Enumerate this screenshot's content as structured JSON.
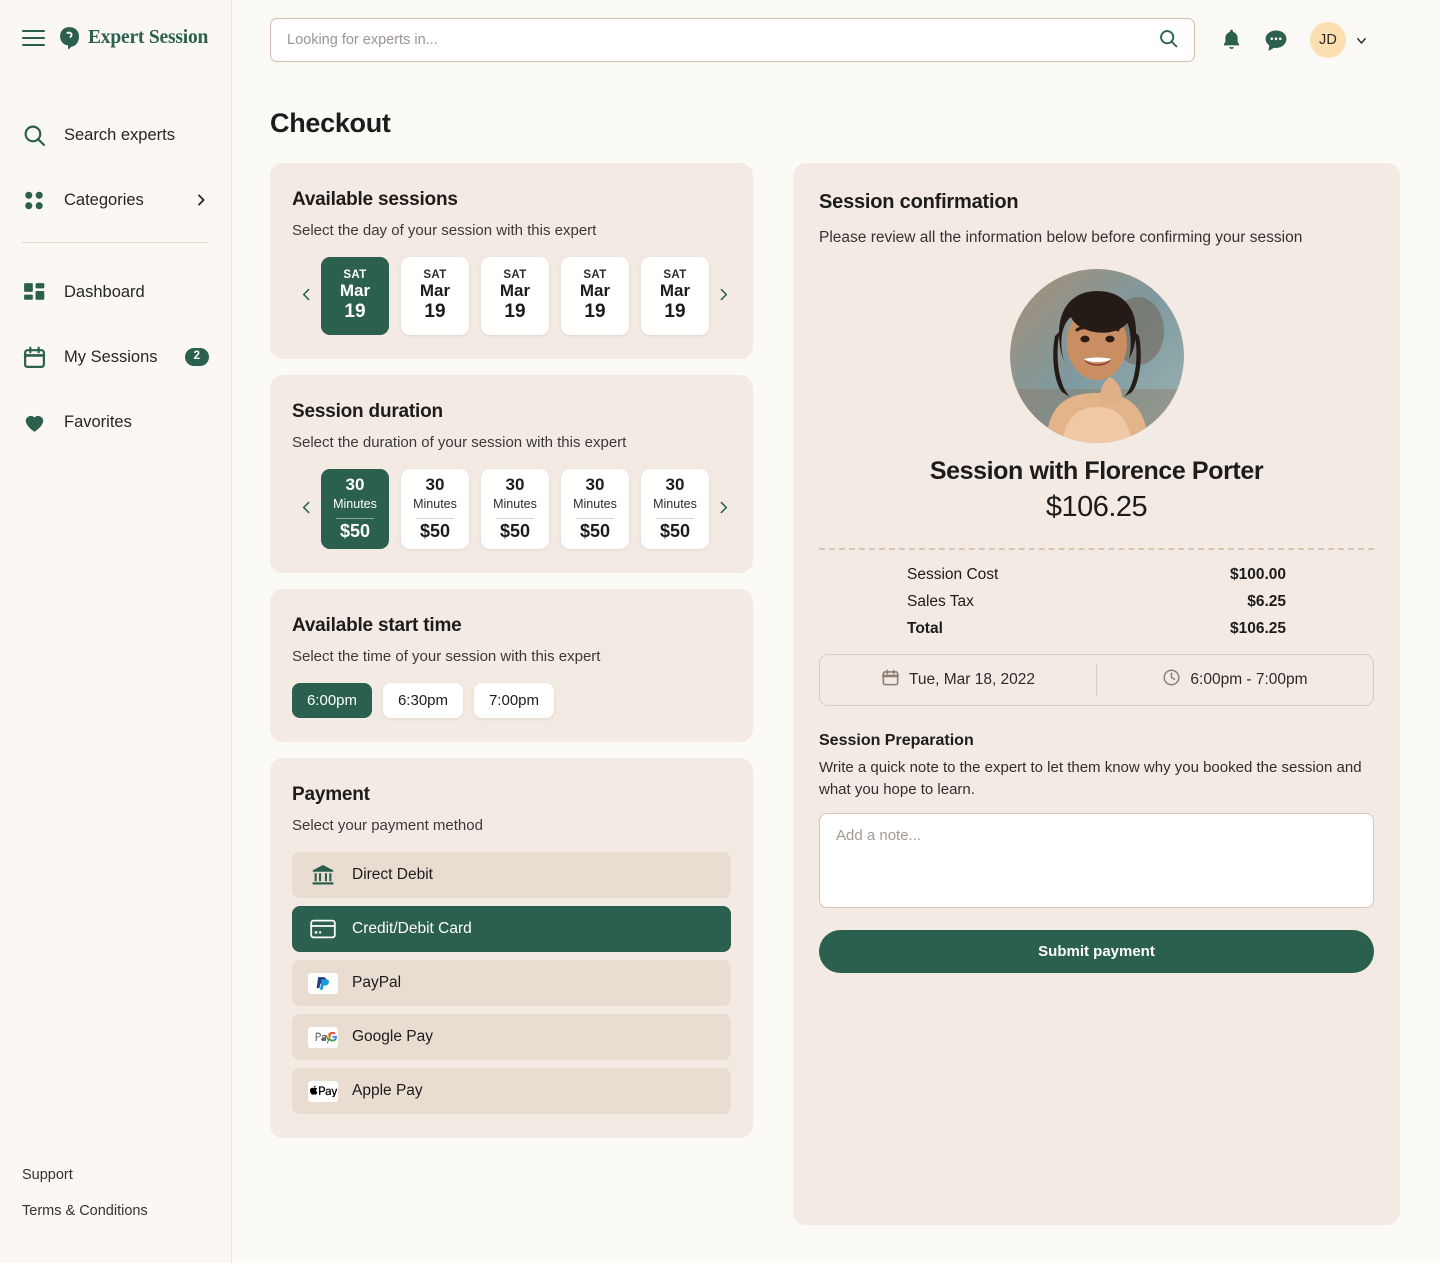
{
  "brand": {
    "name": "Expert Session",
    "logo_icon": "expert-session-logo"
  },
  "sidebar": {
    "primary": [
      {
        "label": "Search experts",
        "icon": "search-icon"
      },
      {
        "label": "Categories",
        "icon": "categories-grid-icon",
        "chevron": "chevron-right-icon"
      }
    ],
    "secondary": [
      {
        "label": "Dashboard",
        "icon": "dashboard-icon"
      },
      {
        "label": "My Sessions",
        "icon": "calendar-icon",
        "badge": "2"
      },
      {
        "label": "Favorites",
        "icon": "heart-icon"
      }
    ],
    "footer": [
      {
        "label": "Support"
      },
      {
        "label": "Terms & Conditions"
      }
    ]
  },
  "topbar": {
    "search_placeholder": "Looking for experts in...",
    "search_value": "",
    "search_icon": "search-icon",
    "notifications_icon": "bell-icon",
    "messages_icon": "chat-bubble-icon",
    "avatar_initials": "JD",
    "avatar_caret": "chevron-down-icon"
  },
  "page": {
    "title": "Checkout"
  },
  "available_sessions": {
    "title": "Available sessions",
    "subtitle": "Select the day of your session with this expert",
    "prev_label": "‹",
    "next_label": "›",
    "days": [
      {
        "dow": "SAT",
        "month": "Mar",
        "day": "19",
        "selected": true
      },
      {
        "dow": "SAT",
        "month": "Mar",
        "day": "19",
        "selected": false
      },
      {
        "dow": "SAT",
        "month": "Mar",
        "day": "19",
        "selected": false
      },
      {
        "dow": "SAT",
        "month": "Mar",
        "day": "19",
        "selected": false
      },
      {
        "dow": "SAT",
        "month": "Mar",
        "day": "19",
        "selected": false
      }
    ]
  },
  "session_duration": {
    "title": "Session duration",
    "subtitle": "Select the duration of your session with this expert",
    "options": [
      {
        "amount": "30",
        "unit": "Minutes",
        "price": "$50",
        "selected": true
      },
      {
        "amount": "30",
        "unit": "Minutes",
        "price": "$50",
        "selected": false
      },
      {
        "amount": "30",
        "unit": "Minutes",
        "price": "$50",
        "selected": false
      },
      {
        "amount": "30",
        "unit": "Minutes",
        "price": "$50",
        "selected": false
      },
      {
        "amount": "30",
        "unit": "Minutes",
        "price": "$50",
        "selected": false
      }
    ]
  },
  "start_time": {
    "title": "Available start time",
    "subtitle": "Select the time of your session with this expert",
    "options": [
      {
        "label": "6:00pm",
        "selected": true
      },
      {
        "label": "6:30pm",
        "selected": false
      },
      {
        "label": "7:00pm",
        "selected": false
      }
    ]
  },
  "payment": {
    "title": "Payment",
    "subtitle": "Select your payment method",
    "methods": [
      {
        "label": "Direct Debit",
        "icon": "bank-icon",
        "selected": false
      },
      {
        "label": "Credit/Debit Card",
        "icon": "credit-card-icon",
        "selected": true
      },
      {
        "label": "PayPal",
        "icon": "paypal-icon",
        "selected": false
      },
      {
        "label": "Google Pay",
        "icon": "google-pay-icon",
        "selected": false
      },
      {
        "label": "Apple Pay",
        "icon": "apple-pay-icon",
        "selected": false
      }
    ]
  },
  "confirmation": {
    "title": "Session confirmation",
    "subtitle": "Please review all the information below before confirming your session",
    "expert_photo": "expert-avatar-photo",
    "session_heading": "Session with Florence Porter",
    "total_price": "$106.25",
    "breakdown": [
      {
        "label": "Session Cost",
        "value": "$100.00"
      },
      {
        "label": "Sales Tax",
        "value": "$6.25"
      },
      {
        "label": "Total",
        "value": "$106.25"
      }
    ],
    "date_icon": "calendar-icon",
    "date_text": "Tue, Mar 18, 2022",
    "time_icon": "clock-icon",
    "time_text": "6:00pm - 7:00pm",
    "prep_title": "Session Preparation",
    "prep_subtitle": "Write a quick note to the expert to let them know why you booked the session and what you hope to learn.",
    "note_placeholder": "Add a note...",
    "note_value": "",
    "submit_label": "Submit payment"
  },
  "colors": {
    "brand_green": "#2B5F4E",
    "page_bg": "#FCFAF7",
    "card_bg": "#F3EAE3",
    "pay_row_bg": "#E9DCD0",
    "avatar_bg": "#FBDFB1"
  }
}
